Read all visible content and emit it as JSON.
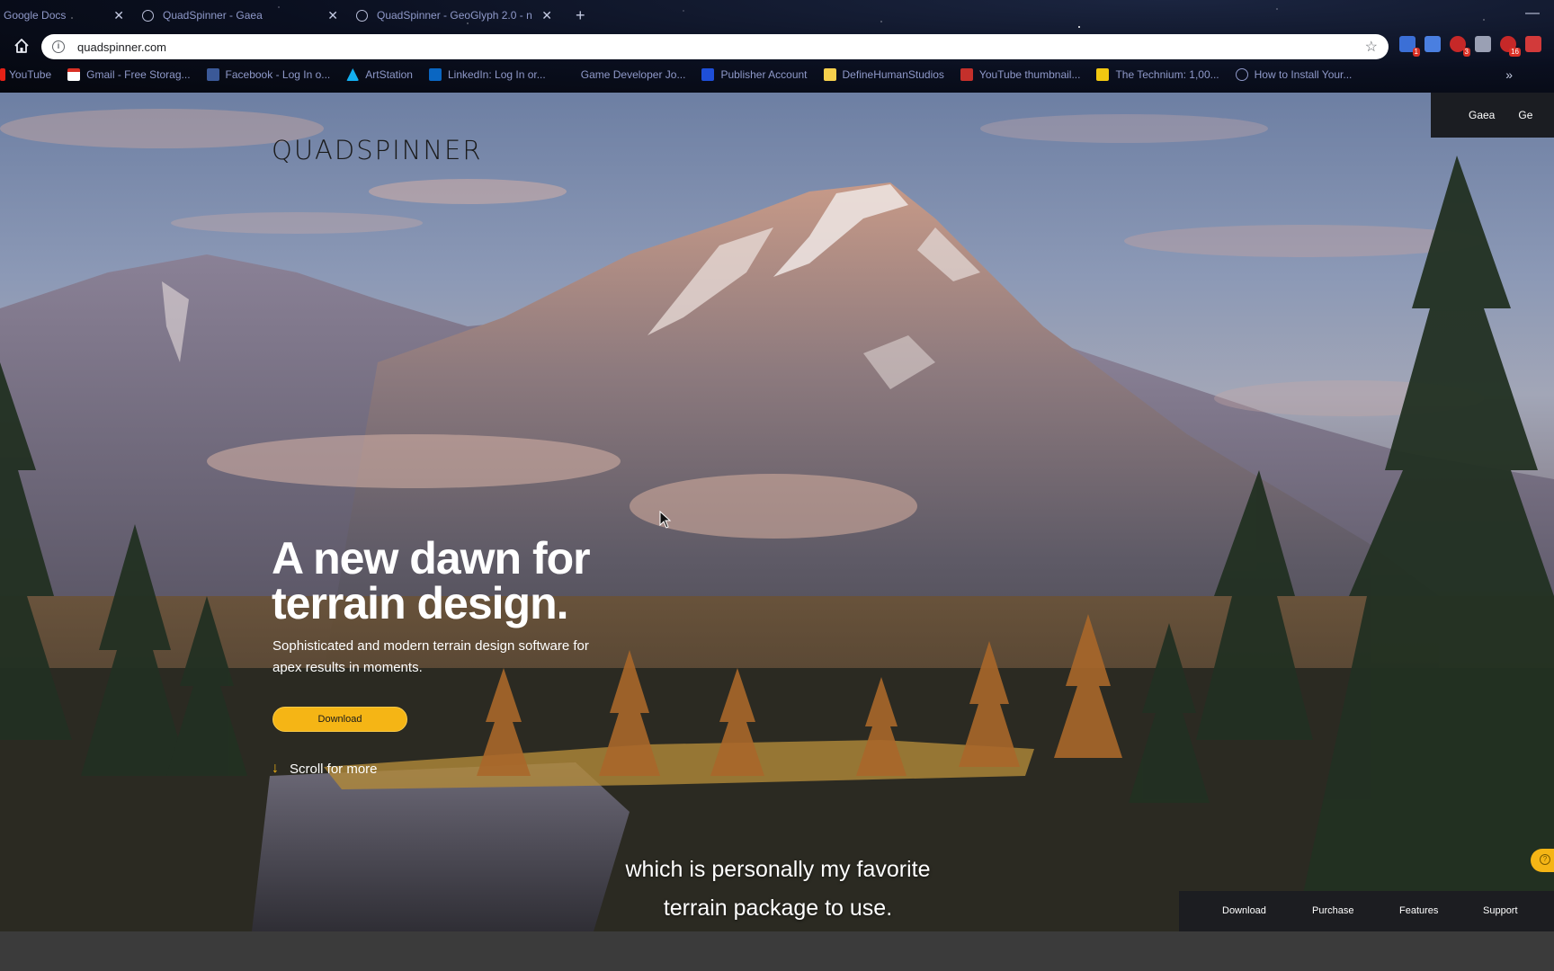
{
  "browser": {
    "tabs": [
      {
        "title": "Google Docs",
        "active": false
      },
      {
        "title": "QuadSpinner - Gaea",
        "active": false
      },
      {
        "title": "QuadSpinner - GeoGlyph 2.0 - n",
        "active": true
      }
    ],
    "url": "quadspinner.com",
    "bookmarks": [
      "YouTube",
      "Gmail - Free Storag...",
      "Facebook - Log In o...",
      "ArtStation",
      "LinkedIn: Log In or...",
      "Game Developer Jo...",
      "Publisher Account",
      "DefineHumanStudios",
      "YouTube thumbnail...",
      "The Technium: 1,00...",
      "How to Install Your..."
    ],
    "extension_badges": {
      "first": "1",
      "third": "3",
      "sixth": "16"
    }
  },
  "site": {
    "logo": "QUADSPINNER",
    "top_nav": [
      "Gaea",
      "Ge"
    ],
    "headline": "A new dawn for terrain design.",
    "subline": "Sophisticated and modern terrain design software for apex results in moments.",
    "download_label": "Download",
    "scroll_label": "Scroll for more",
    "bottom_nav": [
      "Download",
      "Purchase",
      "Features",
      "Support"
    ]
  },
  "caption": {
    "line1": "which is personally my favorite",
    "line2": "terrain package to use."
  },
  "colors": {
    "accent": "#f5b515",
    "nav_bg": "#1c1d21"
  }
}
